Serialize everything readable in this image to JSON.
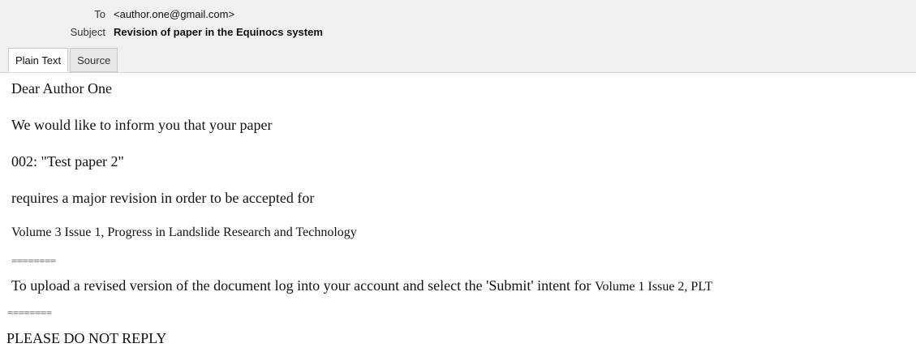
{
  "header": {
    "to_label": "To",
    "to_value": "<author.one@gmail.com>",
    "subject_label": "Subject",
    "subject_value": "Revision of paper in the Equinocs system"
  },
  "tabs": [
    {
      "label": "Plain Text",
      "active": true
    },
    {
      "label": "Source",
      "active": false
    }
  ],
  "body": {
    "greeting": "Dear Author One",
    "line1": "We would like to inform you that your paper",
    "paper": "002: \"Test paper 2\"",
    "line2": "requires a major revision in order to be accepted for",
    "venue": "Volume 3 Issue 1, Progress in Landslide Research and Technology",
    "separator1": "========",
    "upload_main": "To upload a revised version of the document log into your account and select the 'Submit' intent for",
    "upload_venue": "Volume 1 Issue 2, PLT",
    "separator2": "========",
    "footer": "PLEASE DO NOT REPLY"
  }
}
